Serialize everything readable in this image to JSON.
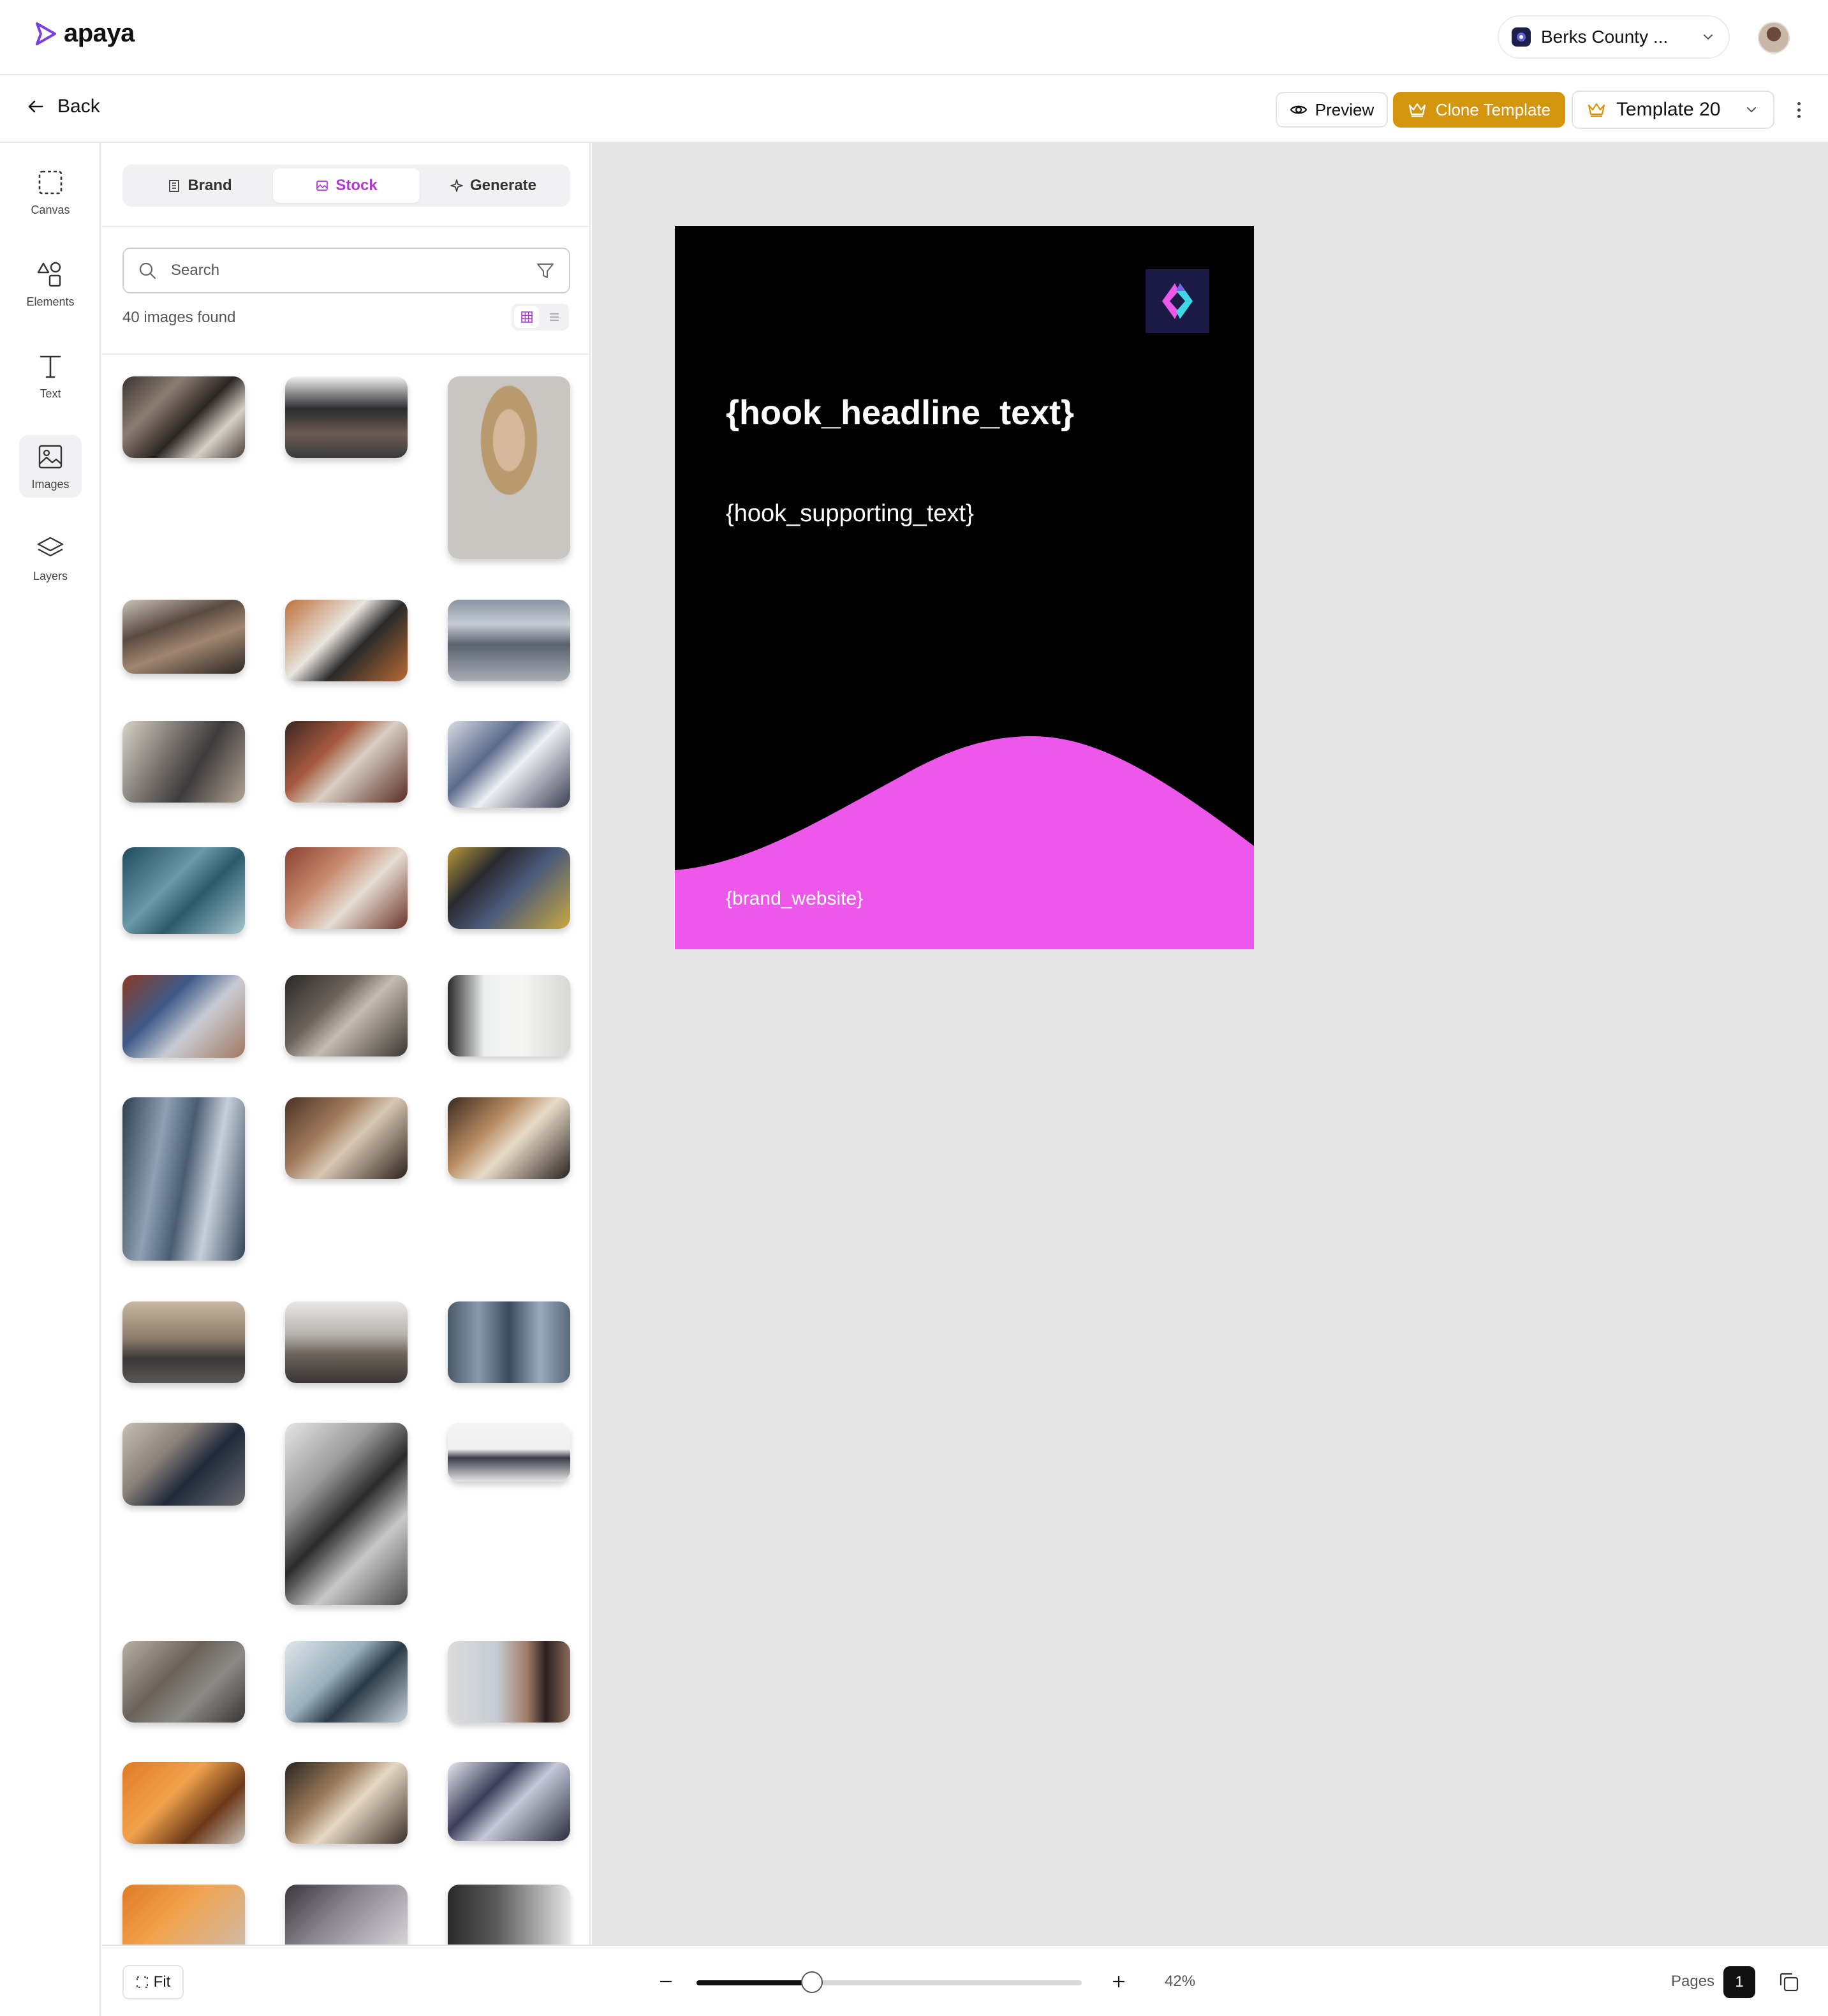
{
  "brand": {
    "name": "apaya",
    "accent": "#7b3fe4"
  },
  "header": {
    "org_name": "Berks County ...",
    "avatar_icon": "user-avatar"
  },
  "toolbar": {
    "back_label": "Back",
    "preview_label": "Preview",
    "clone_label": "Clone Template",
    "template_label": "Template 20",
    "clone_color": "#d4950f"
  },
  "rail": {
    "items": [
      {
        "label": "Canvas",
        "icon": "dashed-square-icon"
      },
      {
        "label": "Elements",
        "icon": "shapes-icon"
      },
      {
        "label": "Text",
        "icon": "text-t-icon"
      },
      {
        "label": "Images",
        "icon": "image-icon",
        "active": true
      },
      {
        "label": "Layers",
        "icon": "layers-icon"
      }
    ]
  },
  "panel": {
    "tabs": [
      {
        "label": "Brand",
        "icon": "building-icon"
      },
      {
        "label": "Stock",
        "icon": "image-icon",
        "active": true
      },
      {
        "label": "Generate",
        "icon": "sparkle-icon"
      }
    ],
    "search_placeholder": "Search",
    "result_count": "40 images found",
    "active_tab_color": "#b13bd6"
  },
  "canvas": {
    "headline": "{hook_headline_text}",
    "supporting": "{hook_supporting_text}",
    "website": "{brand_website}",
    "background_color": "#000000",
    "wave_color": "#ee58ea"
  },
  "bottom": {
    "fit_label": "Fit",
    "zoom_percent": "42%",
    "zoom_fraction": 0.3,
    "pages_label": "Pages",
    "page_number": "1"
  }
}
